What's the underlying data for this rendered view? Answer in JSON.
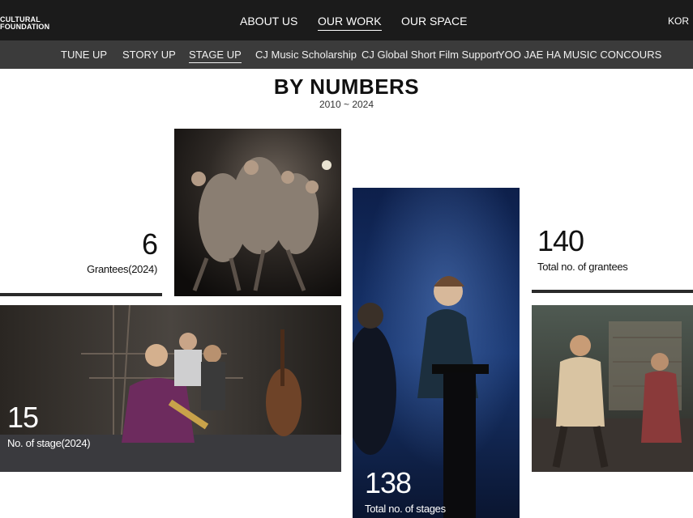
{
  "header": {
    "logo_line1": "CULTURAL",
    "logo_line2": "FOUNDATION",
    "nav": [
      {
        "label": "ABOUT US"
      },
      {
        "label": "OUR WORK"
      },
      {
        "label": "OUR SPACE"
      }
    ],
    "active_nav": "OUR WORK",
    "language": "KOR"
  },
  "subnav": {
    "items": [
      {
        "label": "TUNE UP"
      },
      {
        "label": "STORY UP"
      },
      {
        "label": "STAGE UP"
      },
      {
        "label": "CJ Music Scholarship"
      },
      {
        "label": "CJ Global Short Film Support"
      },
      {
        "label": "YOO JAE HA MUSIC CONCOURS"
      }
    ],
    "active": "STAGE UP"
  },
  "section": {
    "title": "BY NUMBERS",
    "period": "2010 ~ 2024"
  },
  "stats": {
    "grantees_2024": {
      "value": "6",
      "label": "Grantees(2024)"
    },
    "total_grantees": {
      "value": "140",
      "label": "Total no. of grantees"
    },
    "stages_2024": {
      "value": "15",
      "label": "No. of stage(2024)"
    },
    "total_stages": {
      "value": "138",
      "label": "Total no. of stages"
    }
  },
  "colors": {
    "topbar": "#1b1b1b",
    "subbar": "#3b3b3b",
    "text": "#111111"
  }
}
